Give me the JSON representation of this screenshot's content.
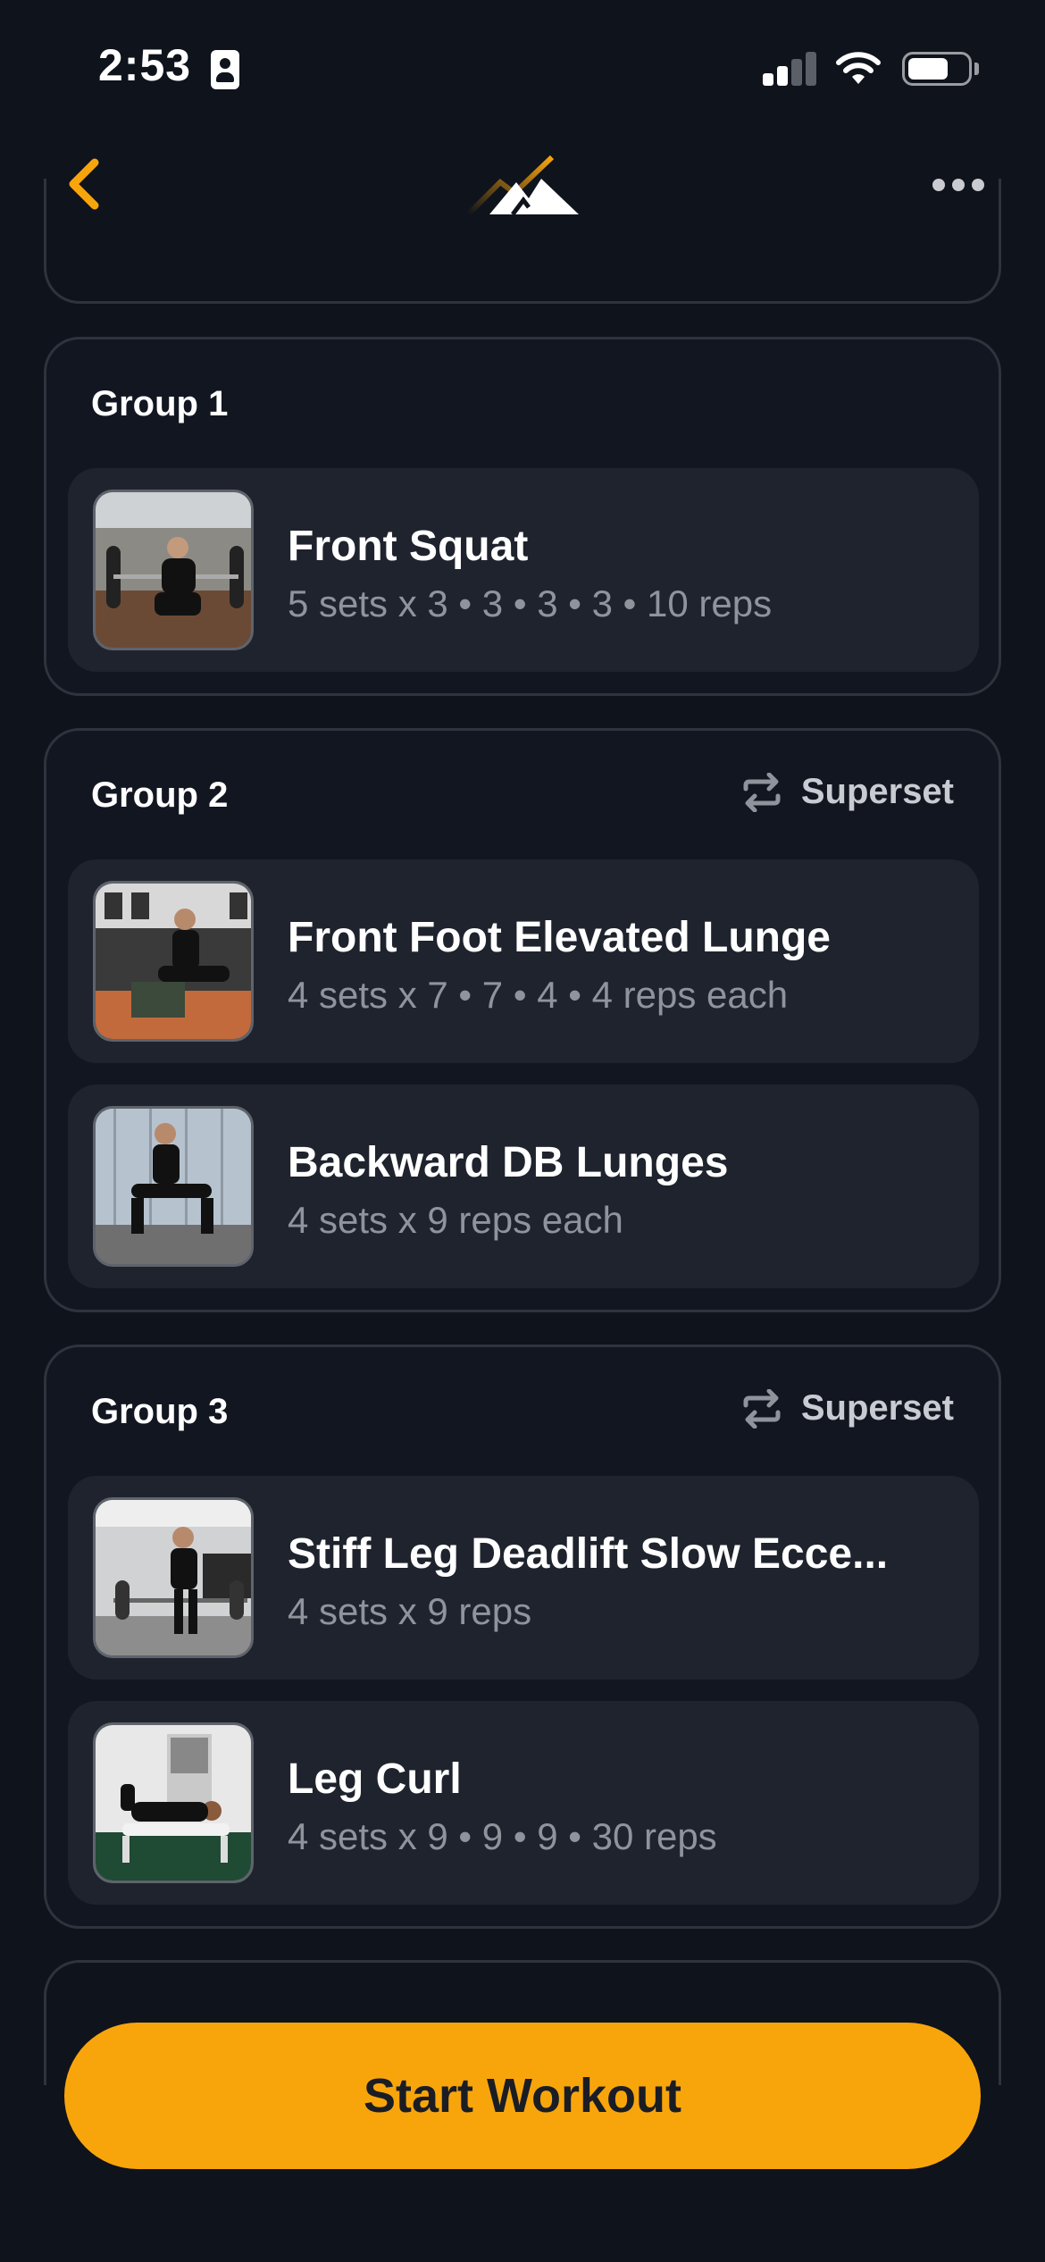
{
  "status_bar": {
    "time": "2:53"
  },
  "nav": {
    "back_icon": "chevron-left-icon",
    "logo_icon": "mountain-logo-icon",
    "more_icon": "ellipsis-icon"
  },
  "groups": [
    {
      "title": "Group 1",
      "tag": "",
      "exercises": [
        {
          "name": "Front Squat",
          "detail": "5 sets x 3 • 3 • 3 • 3 • 10 reps"
        }
      ]
    },
    {
      "title": "Group 2",
      "tag": "Superset",
      "exercises": [
        {
          "name": "Front Foot Elevated Lunge",
          "detail": "4 sets x 7 • 7 • 4 • 4 reps each"
        },
        {
          "name": "Backward DB Lunges",
          "detail": "4 sets x 9 reps each"
        }
      ]
    },
    {
      "title": "Group 3",
      "tag": "Superset",
      "exercises": [
        {
          "name": "Stiff Leg Deadlift Slow Ecce...",
          "detail": "4 sets x 9 reps"
        },
        {
          "name": "Leg Curl",
          "detail": "4 sets x 9 • 9 • 9 • 30 reps"
        }
      ]
    }
  ],
  "start_button": {
    "label": "Start Workout"
  },
  "colors": {
    "background": "#0f131c",
    "accent": "#f8a50c",
    "card": "#1e232d"
  }
}
